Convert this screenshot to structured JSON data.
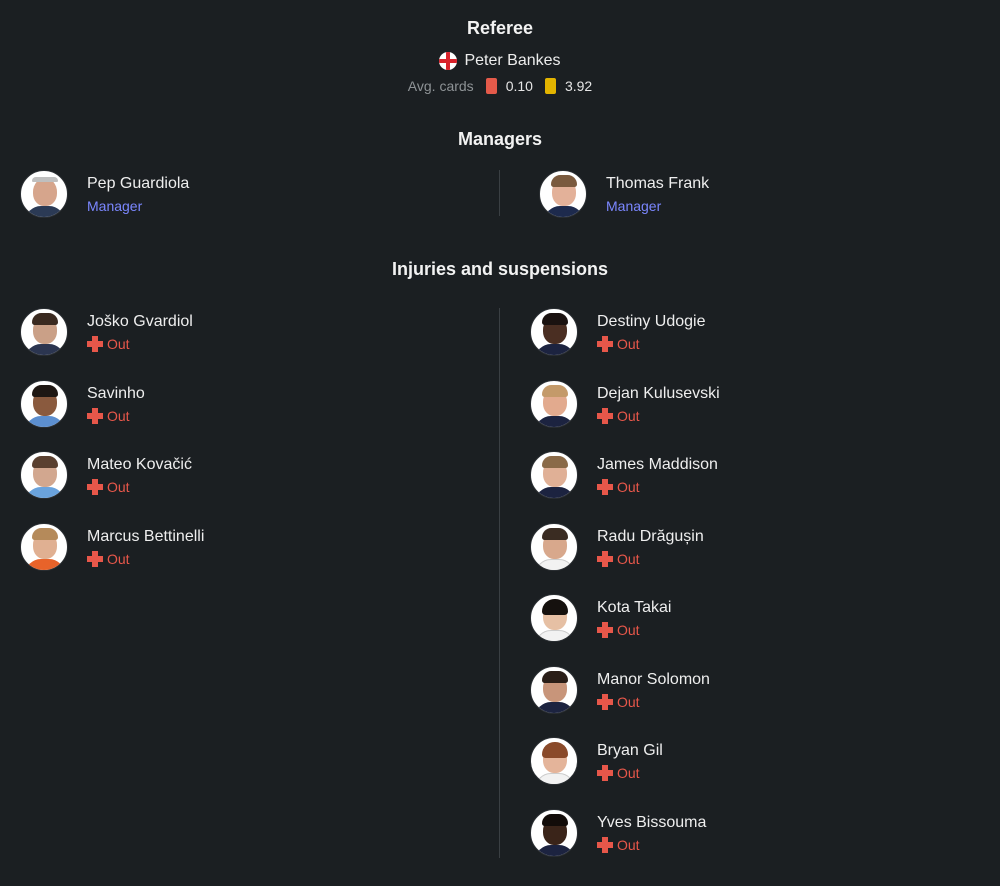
{
  "referee": {
    "title": "Referee",
    "flag": "england-flag-icon",
    "name": "Peter Bankes",
    "avg_cards_label": "Avg. cards",
    "red_avg": "0.10",
    "yellow_avg": "3.92",
    "colors": {
      "red": "#e45a4a",
      "yellow": "#e3b400"
    }
  },
  "managers": {
    "title": "Managers",
    "home": {
      "name": "Pep Guardiola",
      "role": "Manager"
    },
    "away": {
      "name": "Thomas Frank",
      "role": "Manager"
    }
  },
  "injuries": {
    "title": "Injuries and suspensions",
    "status_color": "#e7574a",
    "home": [
      {
        "name": "Joško Gvardiol",
        "status": "Out"
      },
      {
        "name": "Savinho",
        "status": "Out"
      },
      {
        "name": "Mateo Kovačić",
        "status": "Out"
      },
      {
        "name": "Marcus Bettinelli",
        "status": "Out"
      }
    ],
    "away": [
      {
        "name": "Destiny Udogie",
        "status": "Out"
      },
      {
        "name": "Dejan Kulusevski",
        "status": "Out"
      },
      {
        "name": "James Maddison",
        "status": "Out"
      },
      {
        "name": "Radu Drăgușin",
        "status": "Out"
      },
      {
        "name": "Kota Takai",
        "status": "Out"
      },
      {
        "name": "Manor Solomon",
        "status": "Out"
      },
      {
        "name": "Bryan Gil",
        "status": "Out"
      },
      {
        "name": "Yves Bissouma",
        "status": "Out"
      }
    ]
  },
  "theme": {
    "background": "#1b1f22",
    "accent": "#7b87ff",
    "divider": "#3a3f43"
  }
}
